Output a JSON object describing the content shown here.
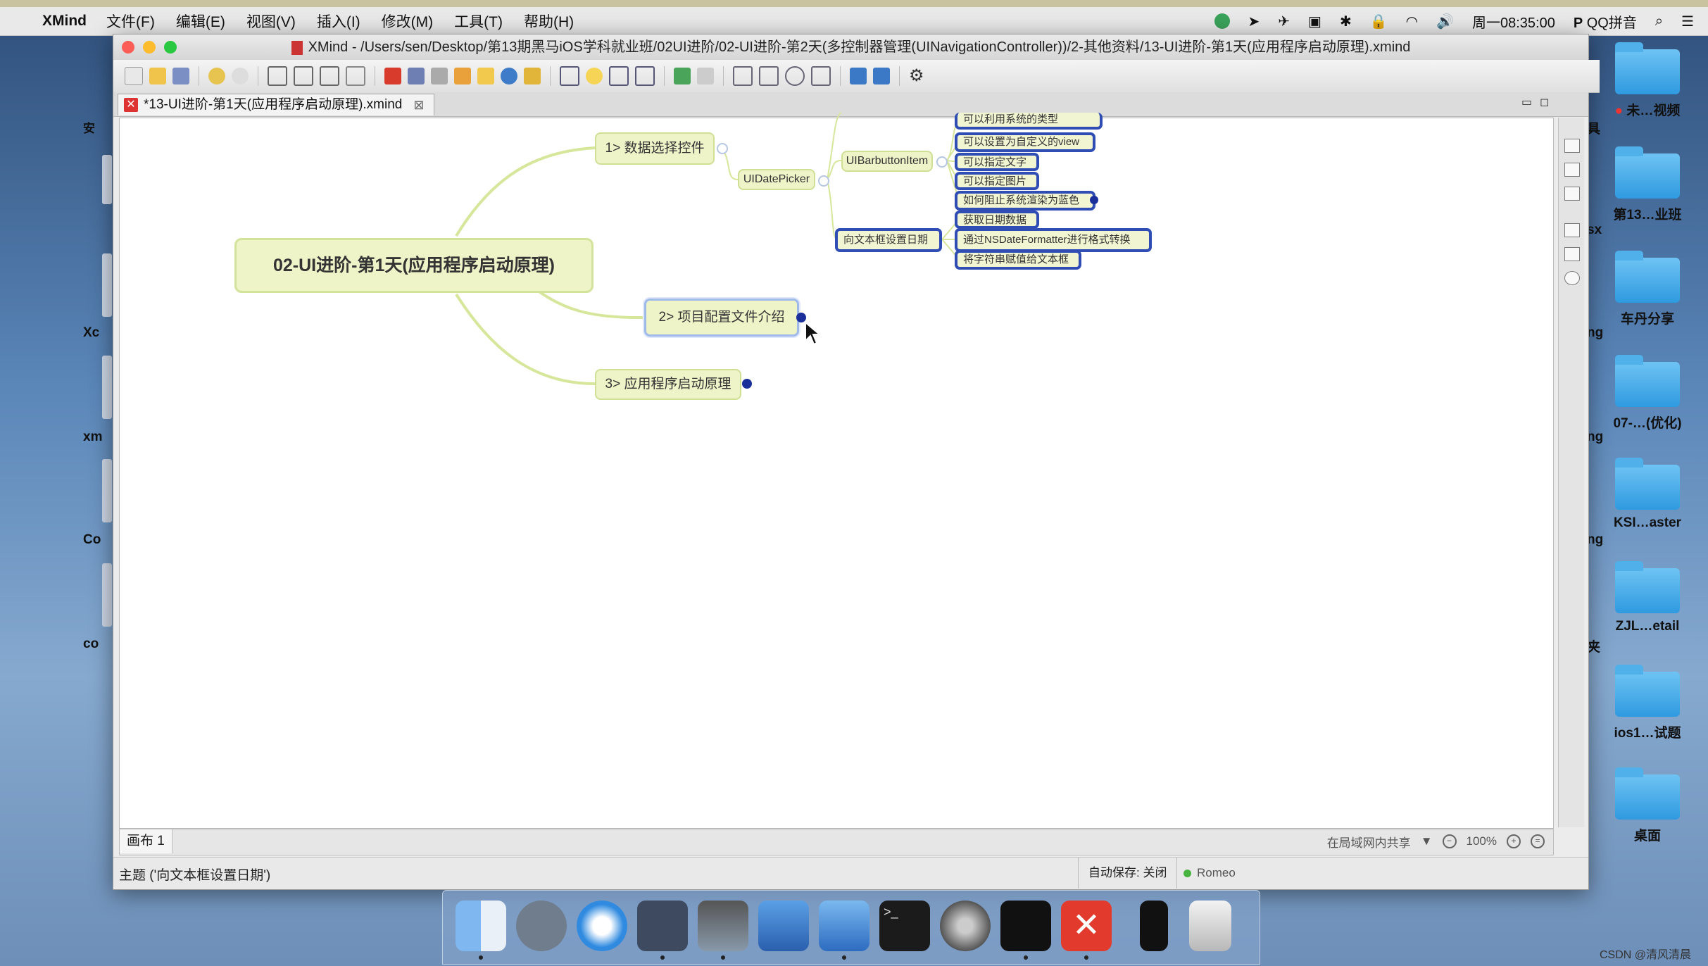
{
  "menubar": {
    "app_name": "XMind",
    "menus": [
      "文件(F)",
      "编辑(E)",
      "视图(V)",
      "插入(I)",
      "修改(M)",
      "工具(T)",
      "帮助(H)"
    ],
    "clock": "周一08:35:00",
    "input_method": "QQ拼音"
  },
  "window": {
    "title": "XMind - /Users/sen/Desktop/第13期黑马iOS学科就业班/02UI进阶/02-UI进阶-第2天(多控制器管理(UINavigationController))/2-其他资料/13-UI进阶-第1天(应用程序启动原理).xmind",
    "tab_label": "*13-UI进阶-第1天(应用程序启动原理).xmind"
  },
  "mindmap": {
    "central": "02-UI进阶-第1天(应用程序启动原理)",
    "branch1": "1> 数据选择控件",
    "branch2": "2> 项目配置文件介绍",
    "branch3": "3> 应用程序启动原理",
    "datepicker": "UIDatePicker",
    "barbutton": "UIBarbuttonItem",
    "textfield_date": "向文本框设置日期",
    "leaves": [
      "可以利用系统的类型",
      "可以设置为自定义的view",
      "可以指定文字",
      "可以指定图片",
      "如何阻止系统渲染为蓝色",
      "获取日期数据",
      "通过NSDateFormatter进行格式转换",
      "将字符串赋值给文本框"
    ]
  },
  "sheetbar": {
    "sheet_tab": "画布 1",
    "share": "在局域网内共享",
    "zoom": "100%"
  },
  "statusbar": {
    "topic": "主题 ('向文本框设置日期')",
    "autosave": "自动保存: 关闭",
    "user": "Romeo"
  },
  "desktop": {
    "right_labels": [
      "未…视频",
      "第13…业班",
      "车丹分享",
      "07-…(优化)",
      "KSI…aster",
      "ZJL…etail",
      "ios1…试题",
      "桌面"
    ],
    "left_labels": [
      "安",
      "Xc",
      "xm",
      "Co",
      "co"
    ],
    "partial_labels": [
      "具",
      "sx",
      "ng",
      "ng",
      "ng",
      "夹"
    ]
  },
  "watermark": "CSDN @清风清晨",
  "colors": {
    "node_fill": "#eef3c8",
    "leaf_border": "#2f4db5",
    "branch_line": "#d6e69a",
    "collapse_dot": "#1b2f9a"
  }
}
